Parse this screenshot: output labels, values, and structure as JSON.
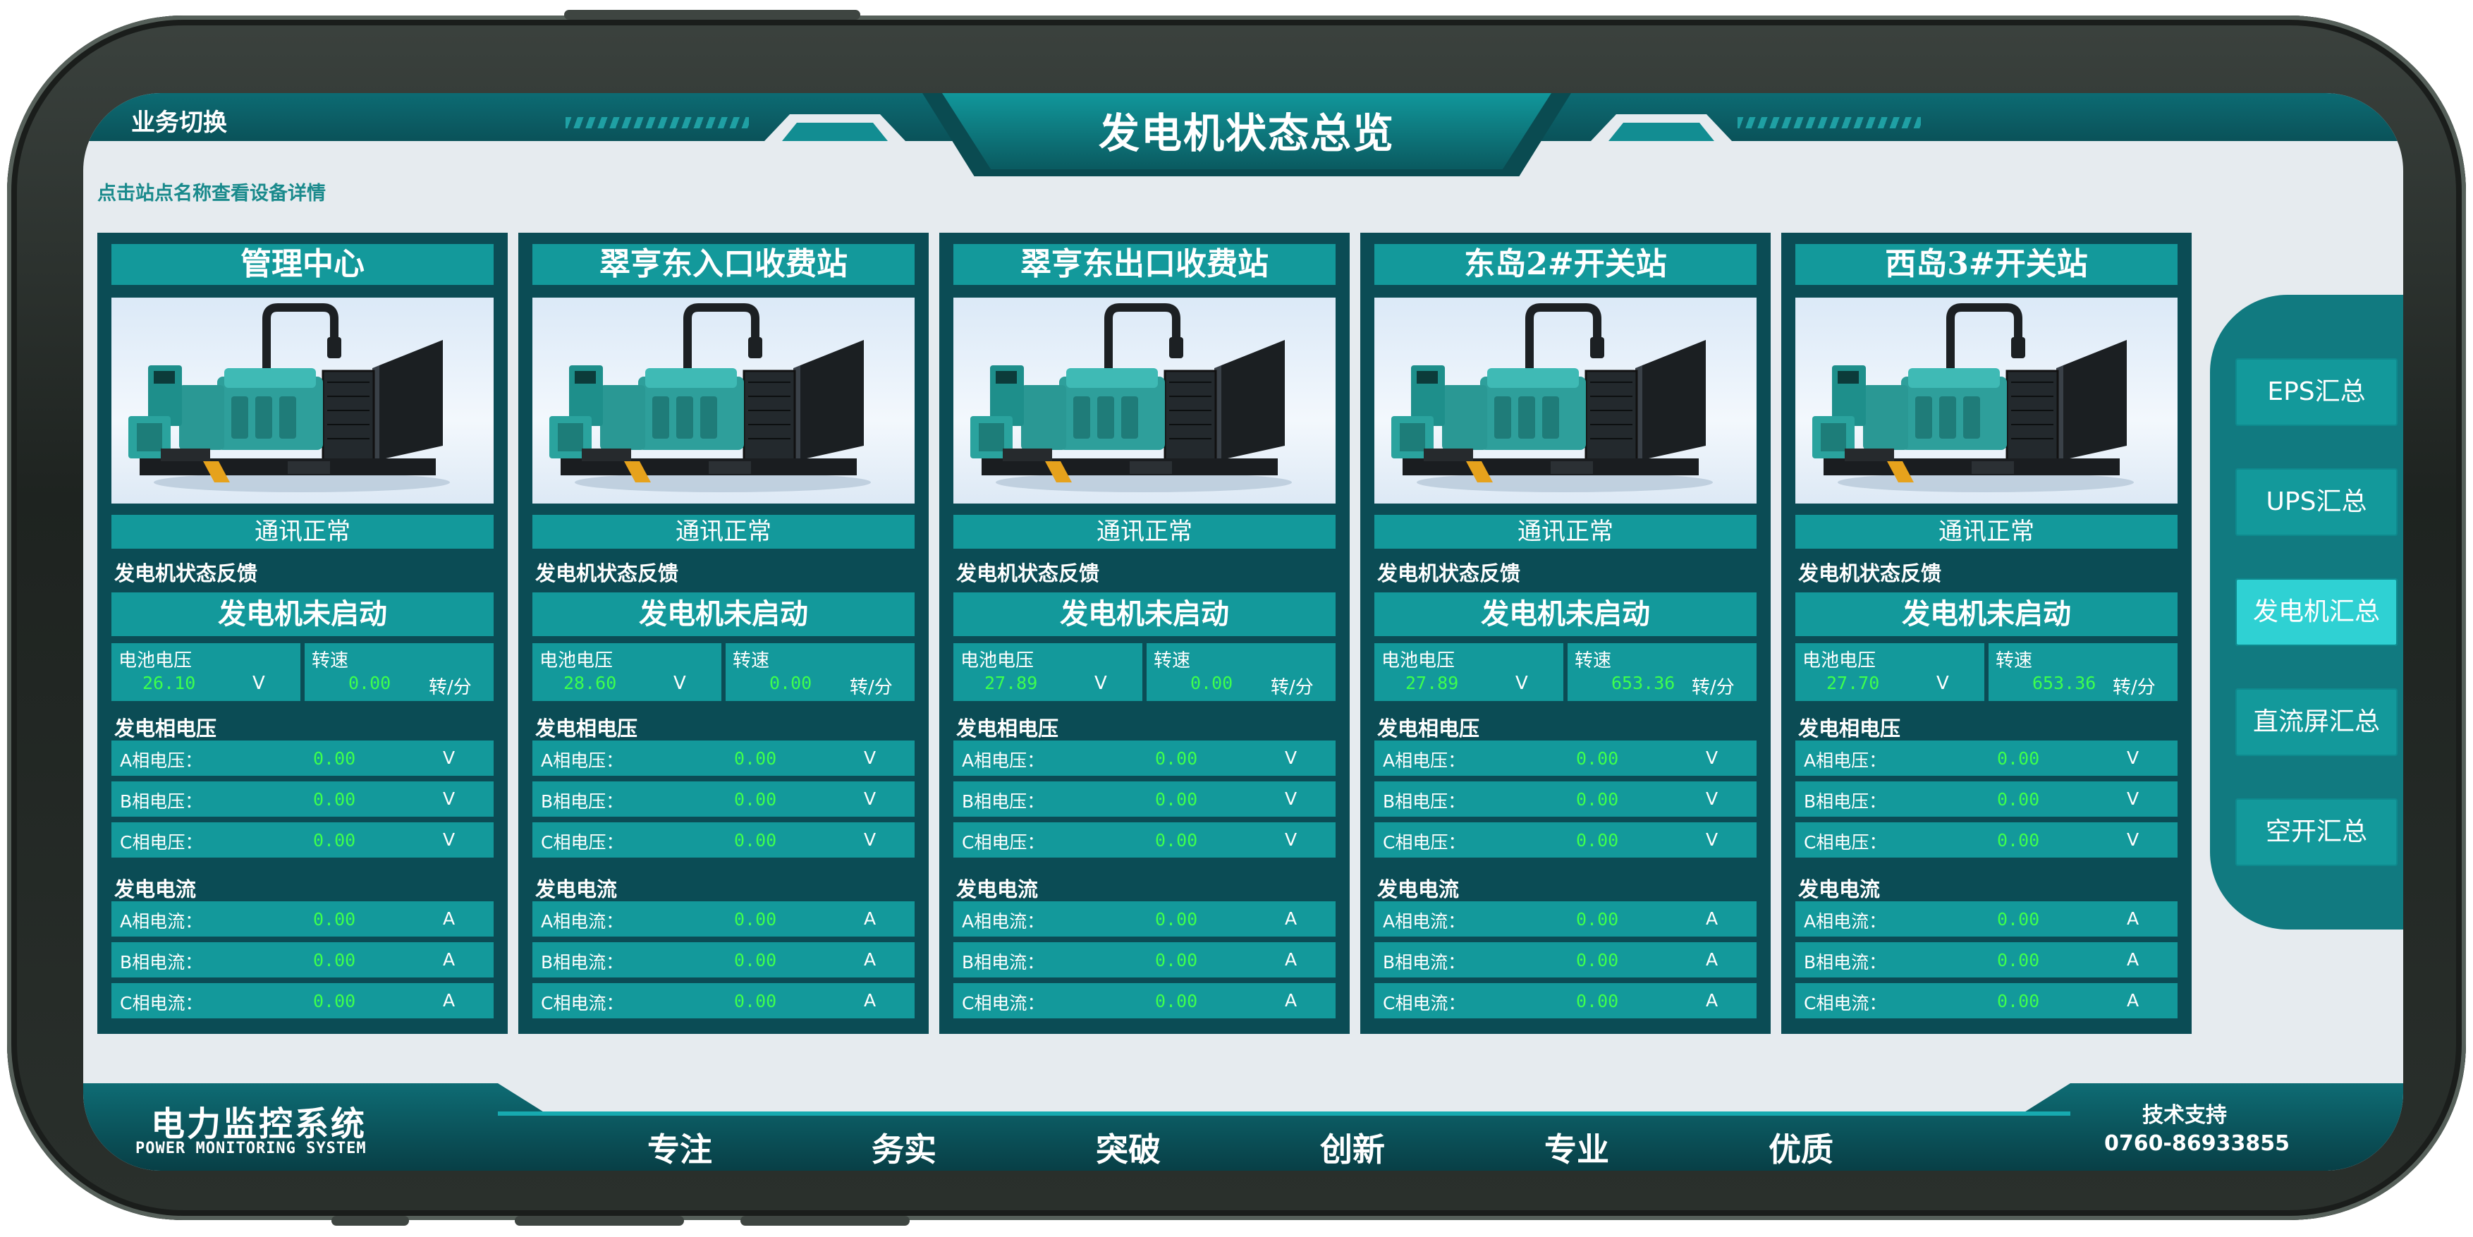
{
  "header": {
    "title": "发电机状态总览",
    "switch_label": "业务切换",
    "hint": "点击站点名称查看设备详情"
  },
  "labels": {
    "status_feedback": "发电机状态反馈",
    "battery_voltage": "电池电压",
    "speed": "转速",
    "phase_voltage_section": "发电相电压",
    "current_section": "发电电流",
    "volt_unit": "V",
    "amp_unit": "A",
    "speed_unit": "转/分",
    "phase_a_voltage": "A相电压：",
    "phase_b_voltage": "B相电压：",
    "phase_c_voltage": "C相电压：",
    "phase_a_current": "A相电流：",
    "phase_b_current": "B相电流：",
    "phase_c_current": "C相电流："
  },
  "stations": [
    {
      "name": "管理中心",
      "comm_status": "通讯正常",
      "gen_state": "发电机未启动",
      "battery_voltage": "26.10",
      "speed": "0.00",
      "voltage_a": "0.00",
      "voltage_b": "0.00",
      "voltage_c": "0.00",
      "current_a": "0.00",
      "current_b": "0.00",
      "current_c": "0.00"
    },
    {
      "name": "翠亨东入口收费站",
      "comm_status": "通讯正常",
      "gen_state": "发电机未启动",
      "battery_voltage": "28.60",
      "speed": "0.00",
      "voltage_a": "0.00",
      "voltage_b": "0.00",
      "voltage_c": "0.00",
      "current_a": "0.00",
      "current_b": "0.00",
      "current_c": "0.00"
    },
    {
      "name": "翠亨东出口收费站",
      "comm_status": "通讯正常",
      "gen_state": "发电机未启动",
      "battery_voltage": "27.89",
      "speed": "0.00",
      "voltage_a": "0.00",
      "voltage_b": "0.00",
      "voltage_c": "0.00",
      "current_a": "0.00",
      "current_b": "0.00",
      "current_c": "0.00"
    },
    {
      "name": "东岛2#开关站",
      "comm_status": "通讯正常",
      "gen_state": "发电机未启动",
      "battery_voltage": "27.89",
      "speed": "653.36",
      "voltage_a": "0.00",
      "voltage_b": "0.00",
      "voltage_c": "0.00",
      "current_a": "0.00",
      "current_b": "0.00",
      "current_c": "0.00"
    },
    {
      "name": "西岛3#开关站",
      "comm_status": "通讯正常",
      "gen_state": "发电机未启动",
      "battery_voltage": "27.70",
      "speed": "653.36",
      "voltage_a": "0.00",
      "voltage_b": "0.00",
      "voltage_c": "0.00",
      "current_a": "0.00",
      "current_b": "0.00",
      "current_c": "0.00"
    }
  ],
  "side_nav": {
    "items": [
      {
        "label": "EPS汇总"
      },
      {
        "label": "UPS汇总"
      },
      {
        "label": "发电机汇总"
      },
      {
        "label": "直流屏汇总"
      },
      {
        "label": "空开汇总"
      }
    ],
    "active_index": 2
  },
  "footer": {
    "system_title": "电力监控系统",
    "system_subtitle": "POWER MONITORING SYSTEM",
    "slogans": [
      "专注",
      "务实",
      "突破",
      "创新",
      "专业",
      "优质"
    ],
    "support_label": "技术支持",
    "support_phone": "0760-86933855"
  },
  "colors": {
    "panel_dark": "#0b4c55",
    "panel_teal": "#13999b",
    "value_green": "#3dff4e",
    "nav_active": "#2fd1d3",
    "screen_bg": "#e6ebef"
  }
}
